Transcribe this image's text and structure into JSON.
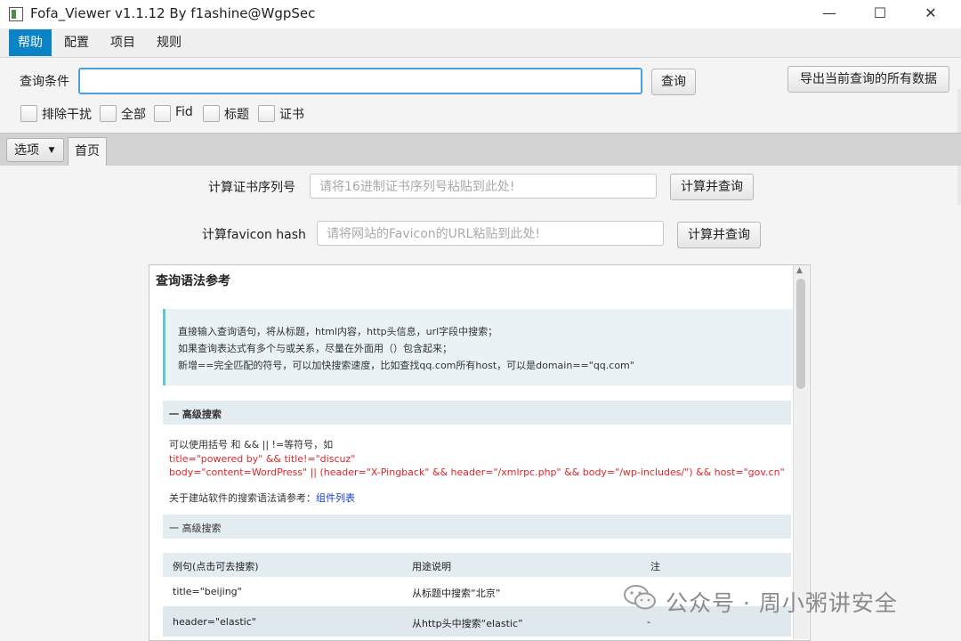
{
  "window": {
    "title": "Fofa_Viewer v1.1.12 By f1ashine@WgpSec",
    "controls": {
      "minimize": "—",
      "maximize": "☐",
      "close": "✕"
    }
  },
  "menu": [
    {
      "label": "帮助",
      "active": true
    },
    {
      "label": "配置"
    },
    {
      "label": "项目"
    },
    {
      "label": "规则"
    }
  ],
  "query": {
    "label": "查询条件",
    "value": "",
    "search_button": "查询",
    "export_button": "导出当前查询的所有数据"
  },
  "filters": [
    {
      "label": "排除干扰",
      "checked": false
    },
    {
      "label": "全部",
      "checked": false
    },
    {
      "label": "Fid",
      "checked": false
    },
    {
      "label": "标题",
      "checked": false
    },
    {
      "label": "证书",
      "checked": false
    }
  ],
  "tabs": {
    "options_button": "选项",
    "options_arrow": "▼",
    "home": "首页"
  },
  "calc": {
    "cert": {
      "label": "计算证书序列号",
      "placeholder": "请将16进制证书序列号粘贴到此处!",
      "button": "计算并查询"
    },
    "favicon": {
      "label": "计算favicon hash",
      "placeholder": "请将网站的Favicon的URL粘贴到此处!",
      "button": "计算并查询"
    }
  },
  "reference": {
    "title": "查询语法参考",
    "intro": [
      "直接输入查询语句，将从标题，html内容，http头信息，url字段中搜索；",
      "如果查询表达式有多个与或关系，尽量在外面用（）包含起来；",
      "新增==完全匹配的符号，可以加快搜索速度，比如查找qq.com所有host，可以是domain==\"qq.com\""
    ],
    "advanced1": {
      "heading": "一  高级搜索",
      "desc": "可以使用括号 和 && || !=等符号，如",
      "example1": "title=\"powered by\" && title!=\"discuz\"",
      "example2": "body=\"content=WordPress\" || (header=\"X-Pingback\" && header=\"/xmlrpc.php\" && body=\"/wp-includes/\") && host=\"gov.cn\"",
      "ref_text": "关于建站软件的搜索语法请参考：",
      "ref_link": "组件列表"
    },
    "advanced2": {
      "heading": "一  高级搜索"
    },
    "table": {
      "headers": [
        "例句(点击可去搜索)",
        "用途说明",
        "注"
      ],
      "rows": [
        {
          "example": "title=\"beijing\"",
          "desc": "从标题中搜索“北京”",
          "note": "-"
        },
        {
          "example": "header=\"elastic\"",
          "desc": "从http头中搜索“elastic”",
          "note": "-"
        }
      ]
    }
  },
  "watermark": "公众号 · 周小粥讲安全"
}
